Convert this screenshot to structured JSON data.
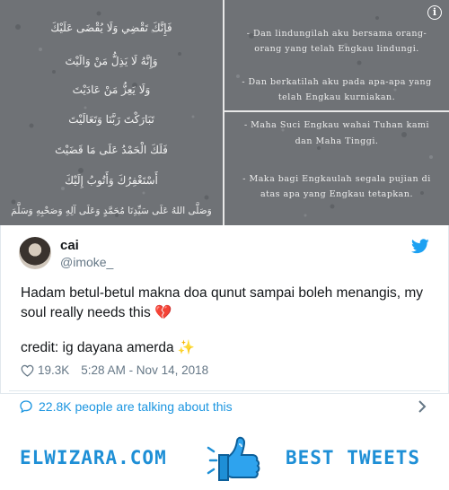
{
  "media": {
    "arabic_lines": [
      "فَإِنَّكَ تَقْضِي وَلَا يُقْضَى عَلَيْكَ",
      "وَإِنَّهُ لَا يَذِلُّ مَنْ وَالَيْتَ",
      "وَلَا يَعِزُّ مَنْ عَادَيْتَ",
      "تَبَارَكْتَ رَبَّنَا وَتَعَالَيْتَ",
      "فَلَكَ الْحَمْدُ عَلَى مَا قَضَيْتَ",
      "أَسْتَغْفِرُكَ وَأَتُوبُ إِلَيْكَ",
      "وَصَلَّى اللهُ عَلَى سَيِّدِنَا مُحَمَّدٍ وَعَلَى آلِهِ وَصَحْبِهِ وَسَلَّمَ"
    ],
    "malay_top": [
      "- Dan lindungilah aku bersama orang-",
      "orang yang telah Engkau lindungi.",
      "- Dan berkatilah aku pada apa-apa yang",
      "telah Engkau kurniakan."
    ],
    "malay_bottom": [
      "- Maha Suci Engkau wahai Tuhan kami",
      "dan Maha Tinggi.",
      "- Maka bagi Engkaulah segala pujian di",
      "atas apa yang Engkau tetapkan."
    ],
    "info_glyph": "i"
  },
  "tweet": {
    "name": "cai",
    "handle": "@imoke_",
    "text": "Hadam betul-betul makna doa qunut sampai boleh menangis, my soul really needs this 💔",
    "credit": "credit: ig dayana amerda ✨",
    "likes": "19.3K",
    "timestamp": "5:28 AM - Nov 14, 2018",
    "talking": "22.8K people are talking about this"
  },
  "footer": {
    "left_brand": "ELWIZARA.COM",
    "right_brand": "BEST TWEETS"
  },
  "colors": {
    "twitter_blue": "#1da1f2",
    "brand_blue": "#1e8fd6",
    "heart_red": "#d2202f"
  }
}
